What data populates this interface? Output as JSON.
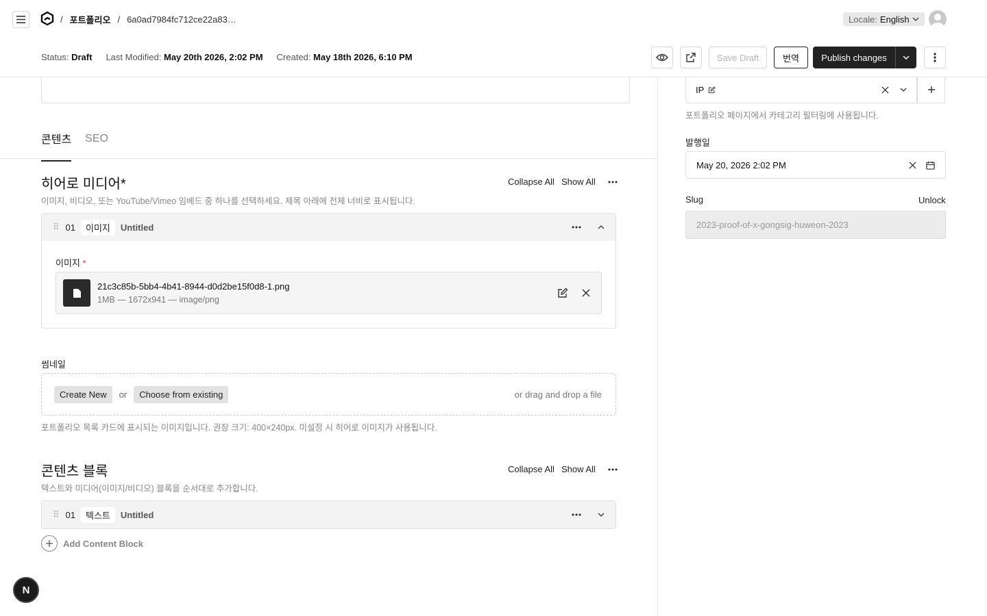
{
  "header": {
    "breadcrumb": {
      "collection": "포트폴리오",
      "doc_id": "6a0ad7984fc712ce22a83…",
      "separator": "/"
    },
    "locale": {
      "label": "Locale:",
      "value": "English"
    }
  },
  "status": {
    "status_key": "Status:",
    "status_val": "Draft",
    "modified_key": "Last Modified:",
    "modified_val": "May 20th 2026, 2:02 PM",
    "created_key": "Created:",
    "created_val": "May 18th 2026, 6:10 PM"
  },
  "toolbar": {
    "save_draft": "Save Draft",
    "translate": "번역",
    "publish": "Publish changes"
  },
  "tabs": [
    {
      "label": "콘텐츠"
    },
    {
      "label": "SEO"
    }
  ],
  "hero": {
    "title": "히어로 미디어*",
    "description": "이미지, 비디오, 또는 YouTube/Vimeo 임베드 중 하나를 선택하세요. 제목 아래에 전체 너비로 표시됩니다.",
    "collapse_all": "Collapse All",
    "show_all": "Show All",
    "block": {
      "number": "01",
      "type": "이미지",
      "title": "Untitled",
      "field_label": "이미지",
      "required_mark": "*",
      "file": {
        "name": "21c3c85b-5bb4-4b41-8944-d0d2be15f0d8-1.png",
        "meta": "1MB — 1672x941 — image/png"
      }
    }
  },
  "thumbnail": {
    "label": "썸네일",
    "create_new": "Create New",
    "or": "or",
    "choose_existing": "Choose from existing",
    "drag_drop": "or drag and drop a file",
    "description": "포트폴리오 목록 카드에 표시되는 이미지입니다. 권장 크기: 400×240px. 미설정 시 히어로 이미지가 사용됩니다."
  },
  "content_blocks": {
    "title": "콘텐츠 블록",
    "description": "텍스트와 미디어(이미지/비디오) 블록을 순서대로 추가합니다.",
    "collapse_all": "Collapse All",
    "show_all": "Show All",
    "block": {
      "number": "01",
      "type": "텍스트",
      "title": "Untitled"
    },
    "add_label": "Add Content Block"
  },
  "sidebar": {
    "category_value": "IP",
    "category_desc": "포트폴리오 페이지에서 카테고리 필터링에 사용됩니다.",
    "publish_date_label": "발행일",
    "publish_date_value": "May 20, 2026 2:02 PM",
    "slug_label": "Slug",
    "slug_unlock": "Unlock",
    "slug_value": "2023-proof-of-x-gongsig-huweon-2023"
  },
  "badge": {
    "letter": "N"
  }
}
